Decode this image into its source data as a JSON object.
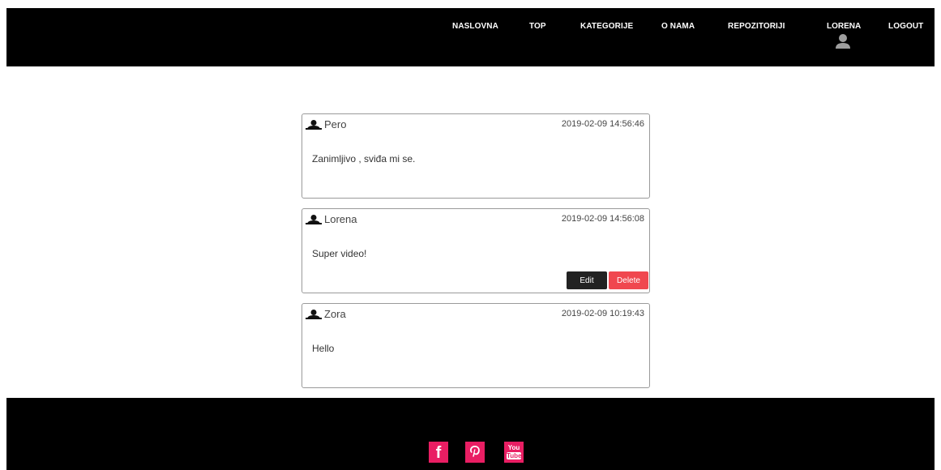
{
  "nav": {
    "items": [
      "NASLOVNA",
      "TOP",
      "KATEGORIJE",
      "O NAMA",
      "REPOZITORIJI"
    ],
    "user": "LORENA",
    "logout": "LOGOUT"
  },
  "comments": [
    {
      "author": "Pero",
      "date": "2019-02-09 14:56:46",
      "text": "Zanimljivo , sviđa mi se."
    },
    {
      "author": "Lorena",
      "date": "2019-02-09 14:56:08",
      "text": "Super video!",
      "edit_label": "Edit",
      "delete_label": "Delete"
    },
    {
      "author": "Zora",
      "date": "2019-02-09 10:19:43",
      "text": "Hello"
    }
  ],
  "footer": {
    "social": [
      "facebook-icon",
      "pinterest-icon",
      "youtube-icon"
    ],
    "youtube_top": "You",
    "youtube_bottom": "Tube"
  },
  "colors": {
    "bar": "#000000",
    "social": "#e91e63",
    "delete": "#f0474f",
    "edit": "#222222"
  }
}
